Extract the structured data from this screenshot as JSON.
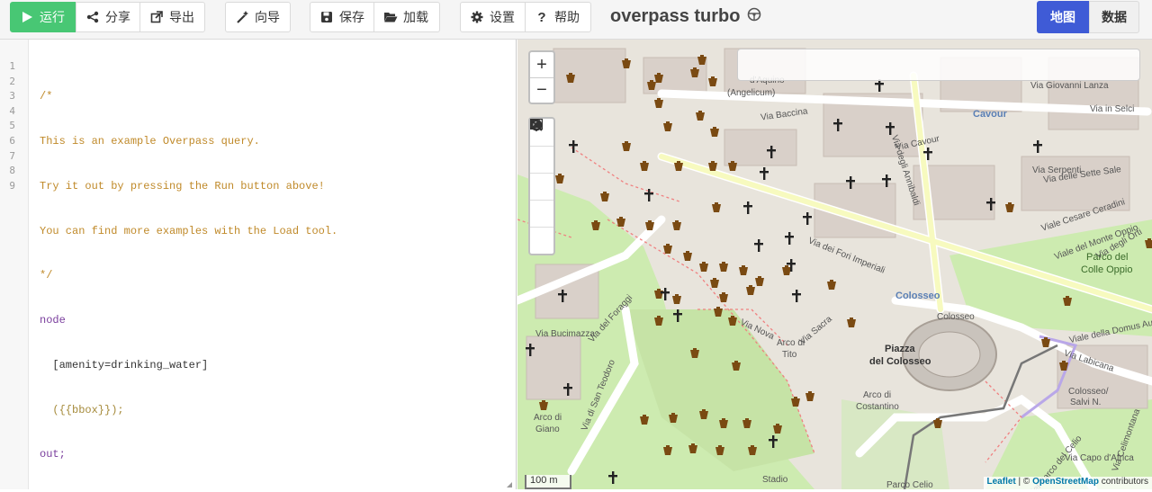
{
  "toolbar": {
    "run": "运行",
    "share": "分享",
    "export": "导出",
    "wizard": "向导",
    "save": "保存",
    "load": "加载",
    "settings": "设置",
    "help": "帮助",
    "title": "overpass turbo",
    "view_map": "地图",
    "view_data": "数据"
  },
  "editor": {
    "line_numbers": [
      "1",
      "2",
      "3",
      "4",
      "5",
      "6",
      "7",
      "8",
      "9"
    ],
    "lines": [
      "/*",
      "This is an example Overpass query.",
      "Try it out by pressing the Run button above!",
      "You can find more examples with the Load tool.",
      "*/",
      "node",
      "  [amenity=drinking_water]",
      "  ({{bbox}});",
      "out;"
    ]
  },
  "map": {
    "places": {
      "cavour": "Cavour",
      "colosseo": "Colosseo",
      "colosseo_small": "Colosseo",
      "piazza": "Piazza",
      "del_colosseo": "del Colosseo",
      "arco_di": "Arco di",
      "tito": "Tito",
      "arco_di_const": "Arco di",
      "costantino": "Costantino",
      "arco_di_giano": "Arco di",
      "giano": "Giano",
      "parco_del": "Parco del",
      "colle_oppio": "Colle Oppio",
      "colosseo_salvi": "Colosseo/",
      "salvi": "Salvi N.",
      "parco_celio": "Parco Celio",
      "stadio": "Stadio",
      "aquino": "d'Aquino",
      "angelicum": "(Angelicum)"
    },
    "streets": {
      "via_baccina": "Via Baccina",
      "via_cavour": "Via Cavour",
      "via_annibaldi": "Via degli Annibaldi",
      "via_fori": "Via dei Fori Imperiali",
      "via_sacra": "Via Sacra",
      "via_nova": "Via Nova",
      "via_foraggi": "Via del Foraggi",
      "via_bucimazza": "Via Bucimazza",
      "via_s_teodoro": "Via di San Teodoro",
      "via_labicana": "Via Labicana",
      "via_domus": "Viale della Domus Aurea",
      "via_serpenti": "Via Serpenti",
      "via_sette_sale": "Via delle Sette Sale",
      "viale_ceradini": "Viale Cesare Ceradini",
      "viale_monte_oppio": "Viale del Monte Oppio",
      "via_degli_orti": "Via degli Orti",
      "via_lanza": "Via Giovanni Lanza",
      "via_selci": "Via in Selci",
      "via_capo_africa": "Via Capo d'Africa",
      "via_celimontana": "Via Celimontana",
      "viale_parco": "Viale del Parco del Celio"
    },
    "scale": "100 m",
    "attribution_leaflet": "Leaflet",
    "attribution_sep": " | © ",
    "attribution_osm": "OpenStreetMap",
    "attribution_tail": " contributors",
    "search_placeholder": ""
  },
  "colors": {
    "run": "#48c774",
    "map_view": "#3f5bd6",
    "comment": "#c08a2a",
    "keyword": "#7a3e9d",
    "pin": "#7a4a12"
  }
}
